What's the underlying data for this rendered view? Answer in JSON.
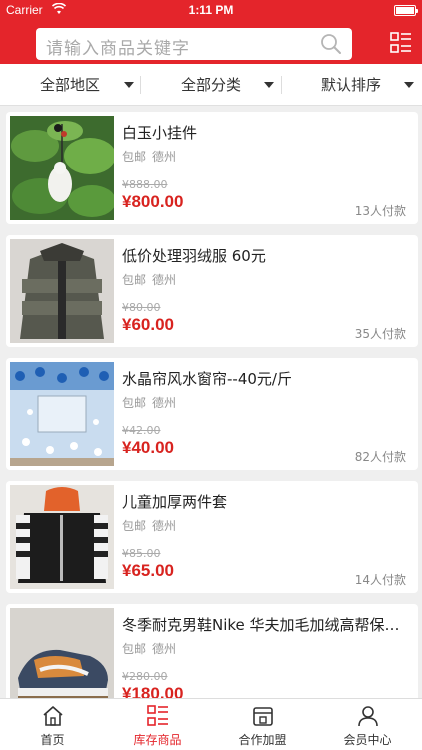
{
  "status_bar": {
    "carrier": "Carrier",
    "time": "1:11 PM"
  },
  "search": {
    "placeholder": "请输入商品关键字",
    "icon": "search-icon"
  },
  "menu_icon": "grid-list-icon",
  "filters": [
    {
      "label": "全部地区"
    },
    {
      "label": "全部分类"
    },
    {
      "label": "默认排序"
    }
  ],
  "products": [
    {
      "title": "白玉小挂件",
      "shipping": "包邮",
      "location": "德州",
      "original_price": "¥888.00",
      "price": "¥800.00",
      "paid": "13人付款"
    },
    {
      "title": "低价处理羽绒服 60元",
      "shipping": "包邮",
      "location": "德州",
      "original_price": "¥80.00",
      "price": "¥60.00",
      "paid": "35人付款"
    },
    {
      "title": "水晶帘风水窗帘--40元/斤",
      "shipping": "包邮",
      "location": "德州",
      "original_price": "¥42.00",
      "price": "¥40.00",
      "paid": "82人付款"
    },
    {
      "title": "儿童加厚两件套",
      "shipping": "包邮",
      "location": "德州",
      "original_price": "¥85.00",
      "price": "¥65.00",
      "paid": "14人付款"
    },
    {
      "title": "冬季耐克男鞋Nike 华夫加毛加绒高帮保暖运动鞋",
      "shipping": "包邮",
      "location": "德州",
      "original_price": "¥280.00",
      "price": "¥180.00",
      "paid": ""
    }
  ],
  "tabs": [
    {
      "label": "首页",
      "icon": "home-icon"
    },
    {
      "label": "库存商品",
      "icon": "list-icon"
    },
    {
      "label": "合作加盟",
      "icon": "store-icon"
    },
    {
      "label": "会员中心",
      "icon": "user-icon"
    }
  ],
  "colors": {
    "brand": "#e4252b",
    "price": "#d8231f"
  }
}
